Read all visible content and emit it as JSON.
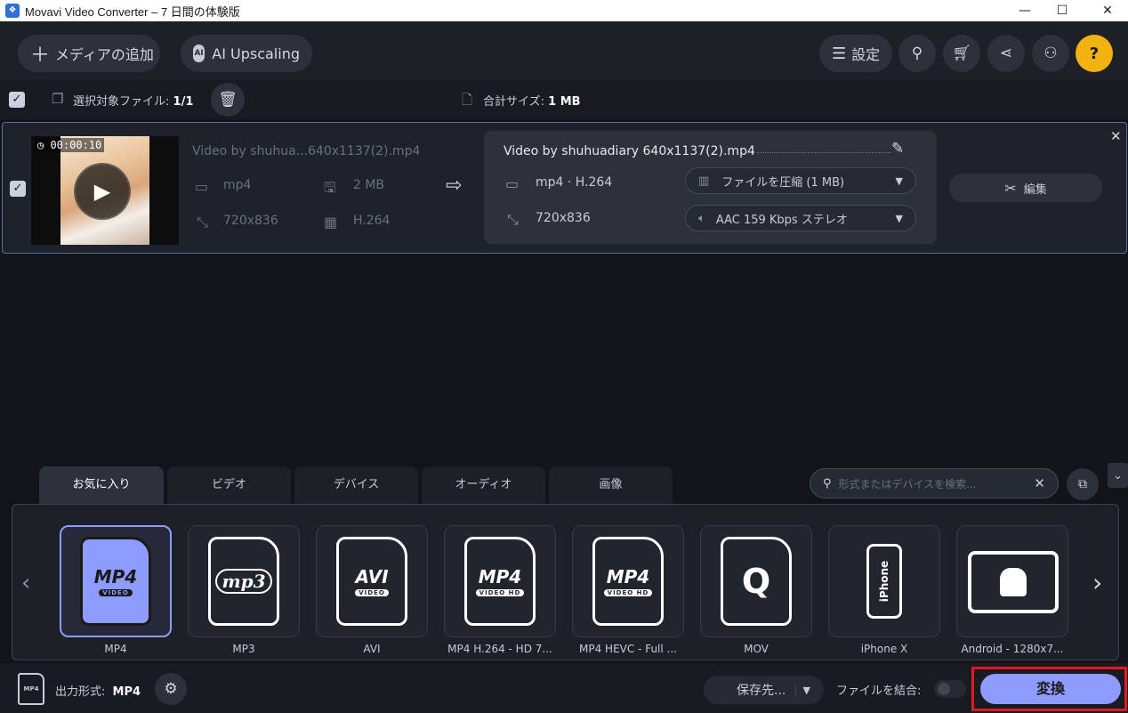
{
  "window": {
    "title": "Movavi Video Converter – 7 日間の体験版",
    "minimize": "—",
    "maximize": "☐",
    "close": "✕"
  },
  "toolbar": {
    "add_media": "メディアの追加",
    "ai_upscaling": "AI Upscaling",
    "settings": "設定"
  },
  "selection": {
    "selected_files_label": "選択対象ファイル:",
    "selected_files_value": "1/1",
    "total_size_label": "合計サイズ:",
    "total_size_value": "1 MB"
  },
  "file": {
    "duration": "00:00:10",
    "source_name": "Video by shuhua...640x1137(2).mp4",
    "source_format": "mp4",
    "source_size": "2 MB",
    "source_resolution": "720x836",
    "source_codec": "H.264",
    "output_name": "Video by shuhuadiary 640x1137(2).mp4",
    "output_format": "mp4 · H.264",
    "output_resolution": "720x836",
    "compress_option": "ファイルを圧縮 (1 MB)",
    "audio_option": "AAC 159 Kbps ステレオ",
    "edit_label": "編集"
  },
  "tabs": [
    {
      "label": "お気に入り",
      "active": true
    },
    {
      "label": "ビデオ"
    },
    {
      "label": "デバイス"
    },
    {
      "label": "オーディオ"
    },
    {
      "label": "画像"
    }
  ],
  "search": {
    "placeholder": "形式またはデバイスを検索..."
  },
  "formats": [
    {
      "label": "MP4",
      "icon_text": "MP4",
      "sub": "VIDEO",
      "selected": true
    },
    {
      "label": "MP3",
      "icon_text": "mp3",
      "sub": ""
    },
    {
      "label": "AVI",
      "icon_text": "AVI",
      "sub": "VIDEO"
    },
    {
      "label": "MP4 H.264 - HD 7...",
      "icon_text": "MP4",
      "sub": "VIDEO HD"
    },
    {
      "label": "MP4 HEVC - Full ...",
      "icon_text": "MP4",
      "sub": "VIDEO HD"
    },
    {
      "label": "MOV",
      "icon_text": "Q",
      "sub": ""
    },
    {
      "label": "iPhone X",
      "icon_text": "iPhone",
      "sub": ""
    },
    {
      "label": "Android - 1280x7...",
      "icon_text": "",
      "sub": ""
    }
  ],
  "bottom": {
    "output_format_label": "出力形式:",
    "output_format_value": "MP4",
    "save_to": "保存先...",
    "merge_files": "ファイルを結合:",
    "convert": "変換"
  },
  "colors": {
    "accent": "#8e9bff",
    "help": "#f2b311",
    "highlight_box": "#e0191f"
  }
}
